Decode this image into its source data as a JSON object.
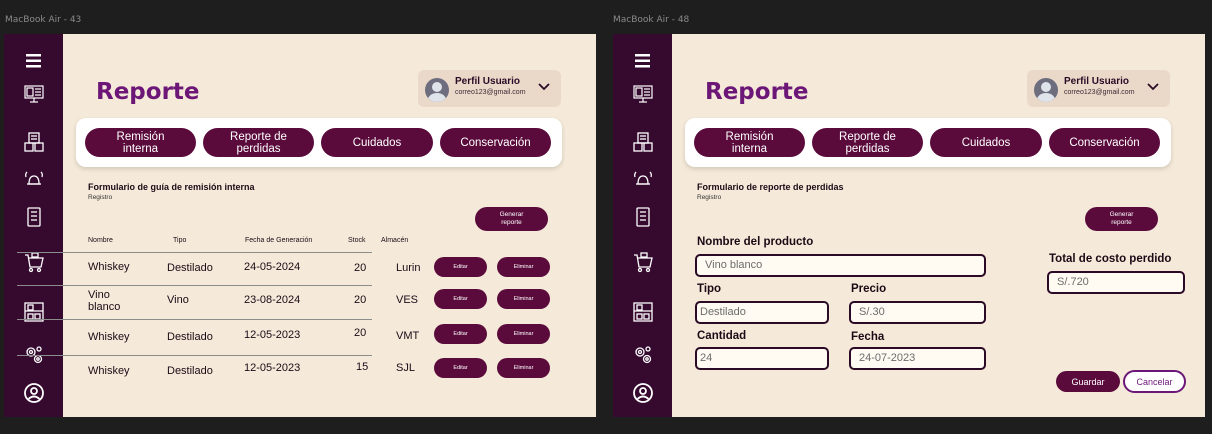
{
  "frames": {
    "left_label": "MacBook Air - 43",
    "right_label": "MacBook Air - 48"
  },
  "sidebar": {
    "icons": [
      "menu-icon",
      "monitor-chart-icon",
      "clipboard-boxes-icon",
      "alarm-icon",
      "document-list-icon",
      "shopping-cart-icon",
      "warehouse-shelf-icon",
      "gears-icon",
      "user-circle-icon"
    ]
  },
  "left": {
    "title": "Reporte",
    "profile": {
      "name": "Perfil Usuario",
      "email": "correo123@gmail.com"
    },
    "tabs": [
      "Remisión\ninterna",
      "Reporte de\nperdidas",
      "Cuidados",
      "Conservación"
    ],
    "form_title": "Formulario de guía de remisión interna",
    "form_subtitle": "Registro",
    "generate_button": "Generar\nreporte",
    "table": {
      "headers": [
        "Nombre",
        "Tipo",
        "Fecha de Generación",
        "Stock",
        "Almacén"
      ],
      "rows": [
        {
          "nombre": "Whiskey",
          "tipo": "Destilado",
          "fecha": "24-05-2024",
          "stock": "20",
          "almacen": "Lurin"
        },
        {
          "nombre": "Vino\nblanco",
          "tipo": "Vino",
          "fecha": "23-08-2024",
          "stock": "20",
          "almacen": "VES"
        },
        {
          "nombre": "Whiskey",
          "tipo": "Destilado",
          "fecha": "12-05-2023",
          "stock": "20",
          "almacen": "VMT"
        },
        {
          "nombre": "Whiskey",
          "tipo": "Destilado",
          "fecha": "12-05-2023",
          "stock": "15",
          "almacen": "SJL"
        }
      ],
      "edit_label": "Editar",
      "delete_label": "Eliminar"
    }
  },
  "right": {
    "title": "Reporte",
    "profile": {
      "name": "Perfil Usuario",
      "email": "correo123@gmail.com"
    },
    "tabs": [
      "Remisión\ninterna",
      "Reporte de\nperdidas",
      "Cuidados",
      "Conservación"
    ],
    "form_title": "Formulario de reporte de perdidas",
    "form_subtitle": "Registro",
    "generate_button": "Generar\nreporte",
    "fields": {
      "producto_label": "Nombre del producto",
      "producto_value": "Vino blanco",
      "tipo_label": "Tipo",
      "tipo_value": "Destilado",
      "precio_label": "Precio",
      "precio_value": "S/.30",
      "cantidad_label": "Cantidad",
      "cantidad_value": "24",
      "fecha_label": "Fecha",
      "fecha_value": "24-07-2023",
      "total_label": "Total de costo perdido",
      "total_value": "S/.720"
    },
    "save_label": "Guardar",
    "cancel_label": "Cancelar"
  },
  "colors": {
    "sidebar": "#36092f",
    "background": "#f5ead9",
    "accent": "#5a0b3c",
    "title": "#6c1777"
  }
}
